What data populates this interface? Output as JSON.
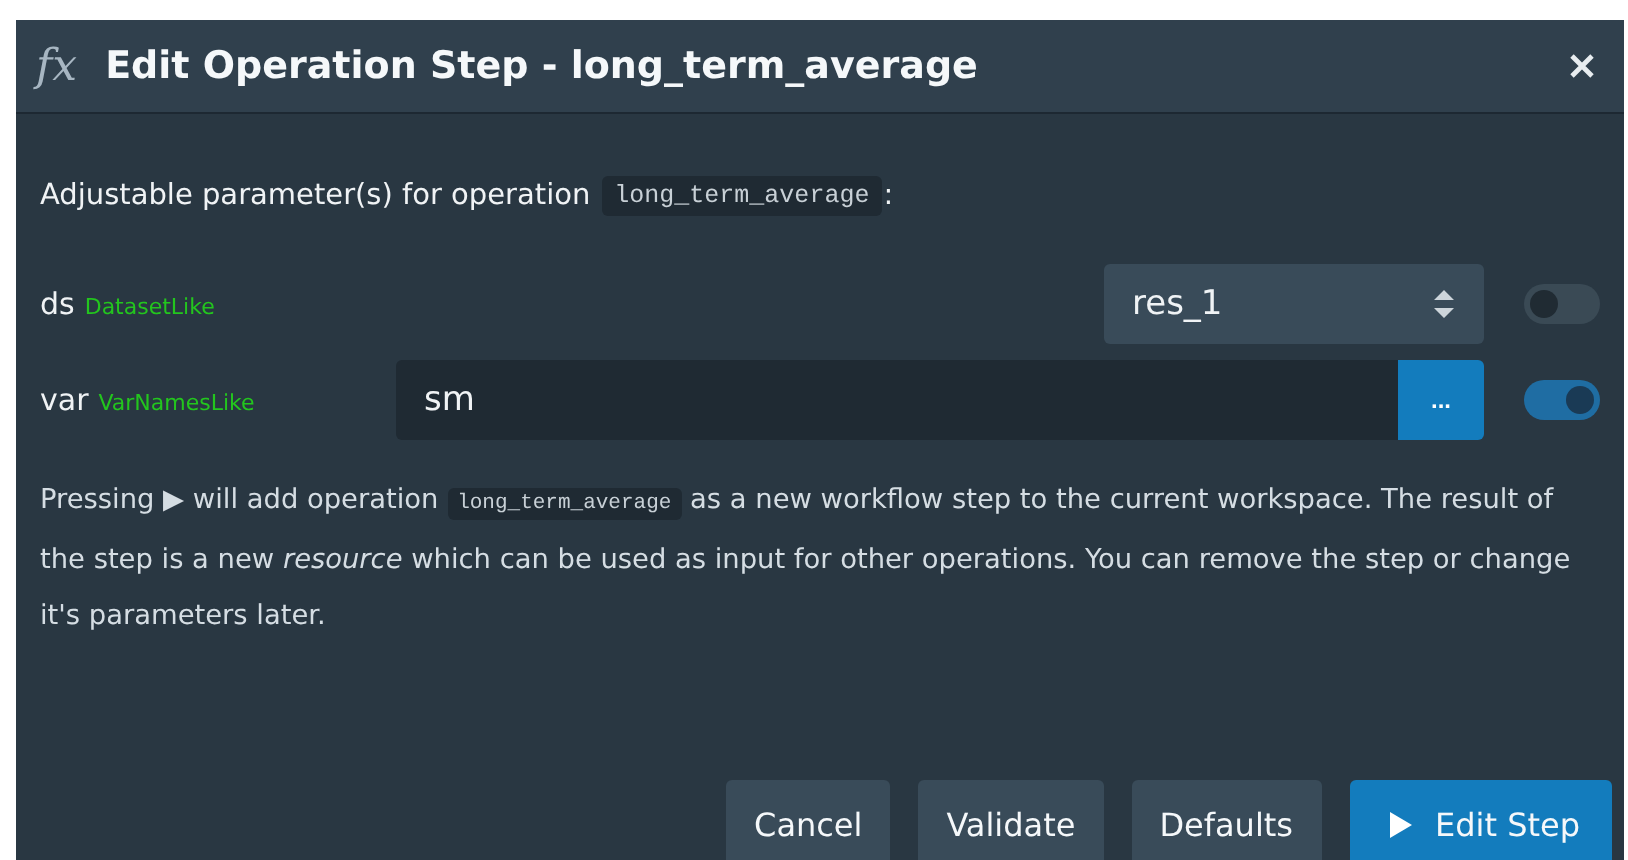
{
  "dialog": {
    "icon": "fx",
    "title": "Edit Operation Step - long_term_average"
  },
  "intro": {
    "text": "Adjustable parameter(s) for operation",
    "code": "long_term_average",
    "after": ":"
  },
  "params": [
    {
      "kind": "select",
      "name": "ds",
      "type": "DatasetLike",
      "value": "res_1",
      "on": false
    },
    {
      "kind": "text",
      "name": "var",
      "type": "VarNamesLike",
      "value": "sm",
      "button": "...",
      "on": true
    }
  ],
  "help": {
    "before": "Pressing ▶ will add operation",
    "code": "long_term_average",
    "after": "as a new workflow step to the current workspace. The result of the step is a new *resource* which can be used as input for other operations. You can remove the step or change it's parameters later."
  },
  "buttons": [
    {
      "label": "Cancel",
      "kind": "plain"
    },
    {
      "label": "Validate",
      "kind": "plain"
    },
    {
      "label": "Defaults",
      "kind": "plain"
    },
    {
      "label": "Edit Step",
      "kind": "primary"
    }
  ]
}
